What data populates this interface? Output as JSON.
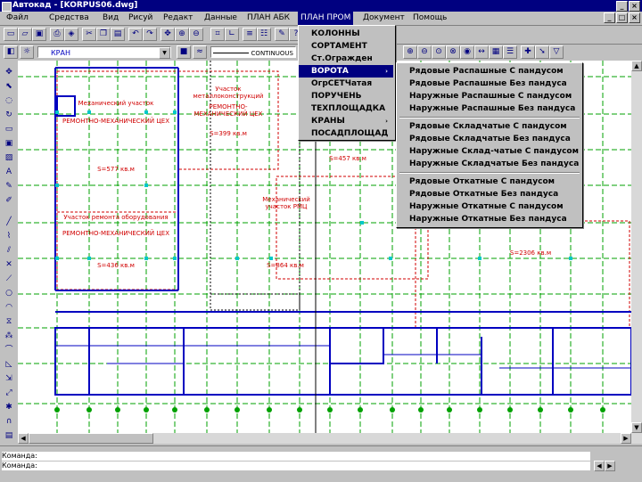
{
  "window": {
    "title": "Автокад - [KORPUS06.dwg]",
    "min": "_",
    "close": "×",
    "min2": "_",
    "max2": "□",
    "close2": "×"
  },
  "menubar": [
    "Файл",
    "Средства",
    "Вид",
    "Рисуй",
    "Редакт",
    "Данные",
    "ПЛАН АБК",
    "ПЛАН ПРОМ",
    "Документ",
    "Помощь"
  ],
  "toolbar2": {
    "layer": "КРАН",
    "linetype": "CONTINUOUS"
  },
  "plan_prom_menu": {
    "items": [
      "КОЛОННЫ",
      "СОРТАМЕНТ",
      "Ст.Огражден",
      "ВОРОТА",
      "ОгрСЕТЧатая",
      "ПОРУЧЕНЬ",
      "ТЕХПЛОЩАДКА",
      "КРАНЫ",
      "ПОСАДПЛОЩАД"
    ],
    "highlighted": "ВОРОТА",
    "submenu_arrow": "›"
  },
  "vorota_submenu": {
    "groups": [
      [
        "Рядовые Распашные С пандусом",
        "Рядовые Распашные Без пандуса",
        "Наружные Распашные С пандусом",
        "Наружные Распашные Без пандуса"
      ],
      [
        "Рядовые Складчатые С пандусом",
        "Рядовые Складчатые Без пандуса",
        "Наружные Склад-чатые С пандусом",
        "Наружные Складчатые Без пандуса"
      ],
      [
        "Рядовые Откатные С пандусом",
        "Рядовые Откатные Без пандуса",
        "Наружные Откатные С пандусом",
        "Наружные Откатные Без пандуса"
      ]
    ]
  },
  "drawing_labels": {
    "room1": "Механический участок",
    "room1b": "РЕМОНТНО-МЕХАНИЧЕСКИЙ ЦЕХ",
    "room2": "Участок ремонта оборудования",
    "room2b": "РЕМОНТНО-МЕХАНИЧЕСКИЙ ЦЕХ",
    "room3": "Участок металлоконструкций",
    "room3b": "РЕМОНТНО-МЕХАНИЧЕСКИЙ ЦЕХ",
    "room4": "Механический участок РМЦ",
    "area1": "S=577 кв.м",
    "area2": "S=436 кв.м",
    "area3": "S=399 кв.м",
    "area4": "S=457 кв.м",
    "area5": "S=864 кв.м",
    "area6": "S=2306 кв.м"
  },
  "command": {
    "line1": "Команда:",
    "line2": "Команда:"
  },
  "colors": {
    "grid": "#00a000",
    "wall": "#0000c0",
    "red": "#d00000",
    "axis": "#00c8c8",
    "menu_hl": "#000080"
  }
}
